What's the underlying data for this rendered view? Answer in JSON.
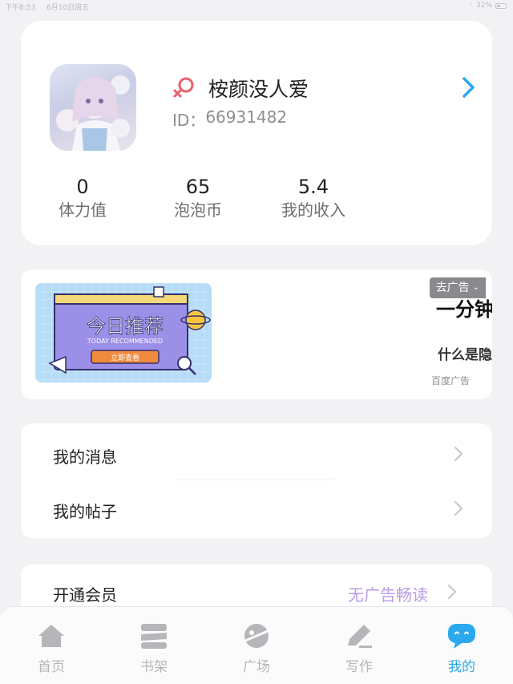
{
  "status_bar": {
    "time": "下午8:53",
    "date": "6月10日周五",
    "battery": "32%"
  },
  "profile": {
    "username": "桉颜没人爱",
    "id_label": "ID：",
    "id_value": "66931482",
    "stats": [
      {
        "value": "0",
        "label": "体力值"
      },
      {
        "value": "65",
        "label": "泡泡币"
      },
      {
        "value": "5.4",
        "label": "我的收入"
      }
    ]
  },
  "ad": {
    "badge": "去广告",
    "title": "一分钟",
    "description": "什么是隐",
    "source": "百度广告",
    "image_text": "今日推荐",
    "image_subtext": "TODAY RECOMMENDED",
    "image_button": "立即查看"
  },
  "menu": {
    "items": [
      {
        "label": "我的消息"
      },
      {
        "label": "我的帖子"
      }
    ]
  },
  "vip": {
    "label": "开通会员",
    "hint": "无广告畅读"
  },
  "tabs": [
    {
      "label": "首页",
      "icon": "home-icon"
    },
    {
      "label": "书架",
      "icon": "bookshelf-icon"
    },
    {
      "label": "广场",
      "icon": "planet-icon"
    },
    {
      "label": "写作",
      "icon": "pen-icon"
    },
    {
      "label": "我的",
      "icon": "chat-bubble-icon",
      "active": true
    }
  ],
  "colors": {
    "accent": "#2aa9ee",
    "vip_hint": "#b79be6",
    "gender": "#e8606f"
  }
}
